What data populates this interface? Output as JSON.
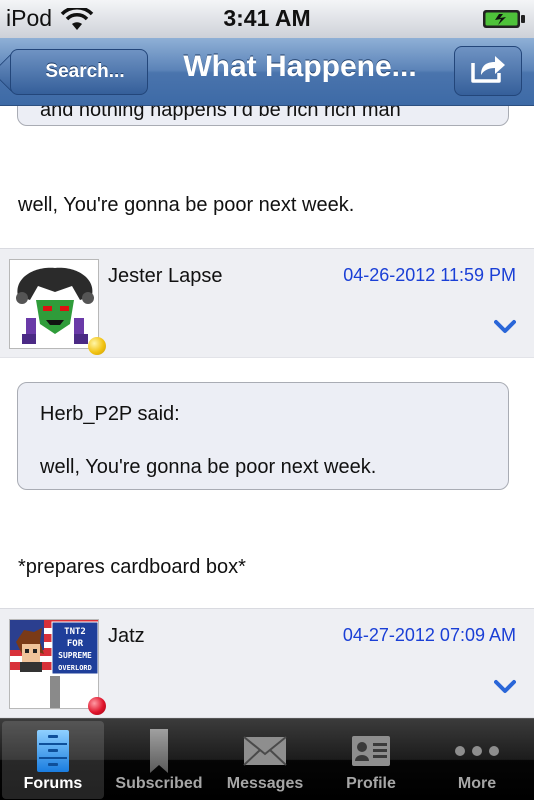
{
  "status_bar": {
    "carrier": "iPod",
    "time": "3:41 AM"
  },
  "nav": {
    "back_label": "Search...",
    "title": "What Happene..."
  },
  "thread": {
    "cut_quote_text": "and nothing happens I'd be rich rich man",
    "top_reply_text": "well, You're gonna be poor next week.",
    "posts": [
      {
        "username": "Jester Lapse",
        "date": "04-26-2012 11:59 PM",
        "status_color": "#f2c313",
        "quote_author": "Herb_P2P said:",
        "quote_text": "well, You're gonna be poor next week.",
        "body": "*prepares cardboard box*"
      },
      {
        "username": "Jatz",
        "date": "04-27-2012 07:09 AM",
        "status_color": "#e0142b",
        "avatar_sign": [
          "TNT2",
          "FOR",
          "SUPREME",
          "OVERLORD"
        ]
      }
    ]
  },
  "tabs": [
    {
      "label": "Forums",
      "icon": "file-cabinet-icon",
      "active": true
    },
    {
      "label": "Subscribed",
      "icon": "bookmark-icon",
      "active": false
    },
    {
      "label": "Messages",
      "icon": "envelope-icon",
      "active": false
    },
    {
      "label": "Profile",
      "icon": "id-card-icon",
      "active": false
    },
    {
      "label": "More",
      "icon": "more-dots-icon",
      "active": false
    }
  ],
  "colors": {
    "nav_blue": "#4a74ad",
    "date_blue": "#1a3fd6",
    "header_gray": "#eeeff3"
  }
}
